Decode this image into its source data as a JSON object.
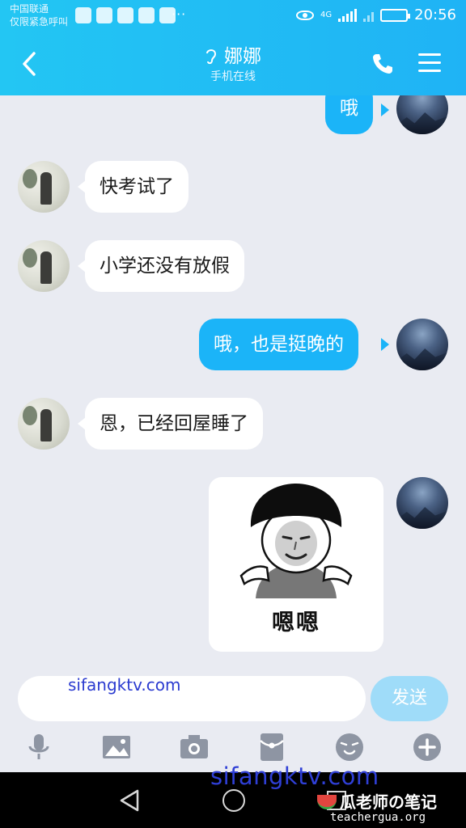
{
  "status_bar": {
    "carrier_line1": "中国联通",
    "carrier_line2": "仅限紧急呼叫",
    "more": "···",
    "network": "4G",
    "time": "20:56"
  },
  "header": {
    "title": "娜娜",
    "subtitle": "手机在线",
    "icons": [
      "back-arrow-icon",
      "ear-icon",
      "phone-icon",
      "menu-icon"
    ]
  },
  "messages": [
    {
      "from": "self",
      "text": "哦"
    },
    {
      "from": "other",
      "text": "快考试了"
    },
    {
      "from": "other",
      "text": "小学还没有放假"
    },
    {
      "from": "self",
      "text": "哦，也是挺晚的"
    },
    {
      "from": "other",
      "text": "恩，已经回屋睡了"
    },
    {
      "from": "self",
      "type": "sticker",
      "text": "嗯嗯"
    }
  ],
  "input": {
    "value": "",
    "overlay_watermark": "sifangktv.com",
    "send_label": "发送"
  },
  "toolbar": {
    "icons": [
      "microphone-icon",
      "image-icon",
      "camera-icon",
      "red-packet-icon",
      "emoji-icon",
      "plus-icon"
    ]
  },
  "watermarks": {
    "large": "sifangktv.com",
    "brand": "瓜老师の笔记",
    "brand_url": "teachergua.org"
  },
  "colors": {
    "header": "#1fb3f5",
    "outgoing_bubble": "#1bb4f8",
    "chat_background": "#e9ebf2",
    "send_button": "#9fdcf9"
  }
}
